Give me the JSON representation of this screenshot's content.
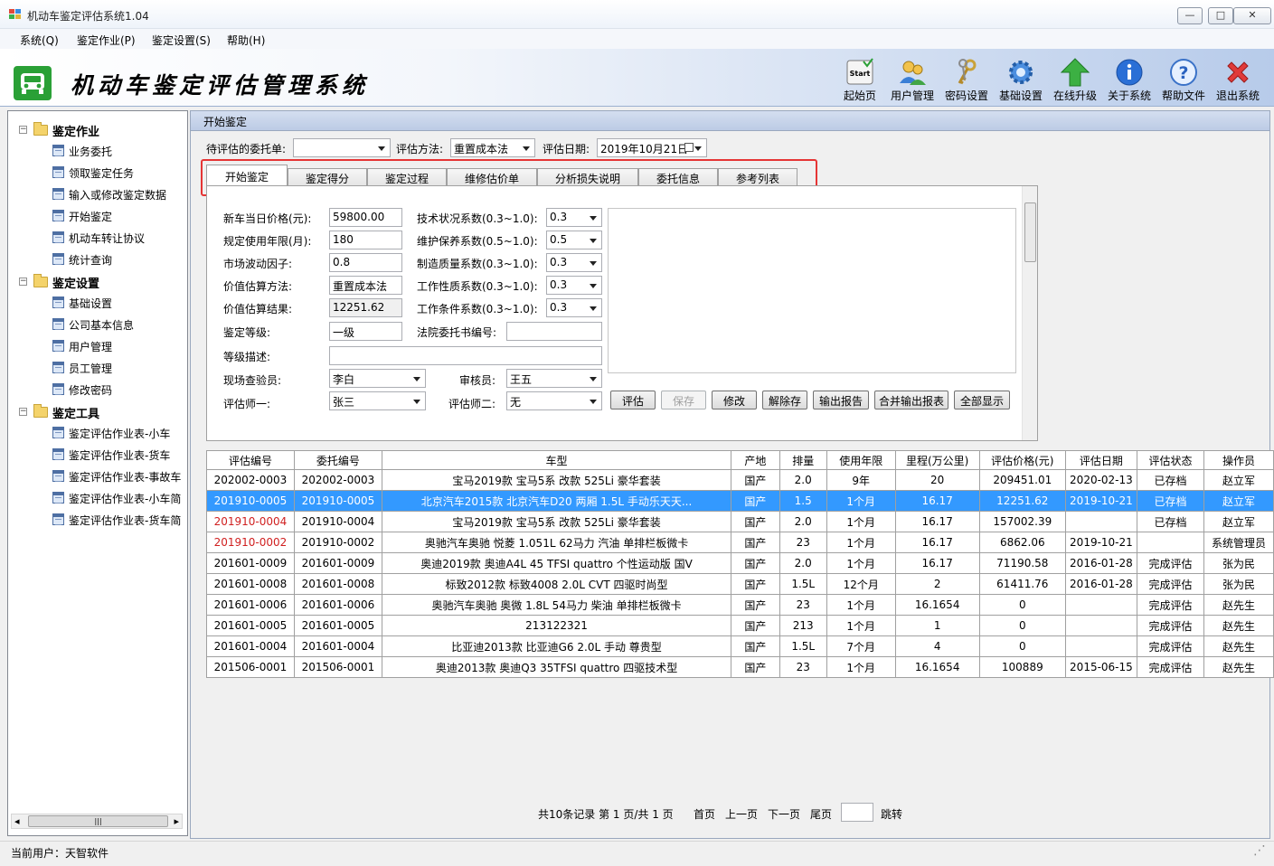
{
  "window": {
    "title": "机动车鉴定评估系统1.04",
    "min": "—",
    "max": "□",
    "close": "✕"
  },
  "menu": [
    "系统(Q)",
    "鉴定作业(P)",
    "鉴定设置(S)",
    "帮助(H)"
  ],
  "banner": {
    "title": "机动车鉴定评估管理系统"
  },
  "toolbar": [
    {
      "label": "起始页",
      "icon": "start-icon"
    },
    {
      "label": "用户管理",
      "icon": "users-icon"
    },
    {
      "label": "密码设置",
      "icon": "keys-icon"
    },
    {
      "label": "基础设置",
      "icon": "gear-icon"
    },
    {
      "label": "在线升级",
      "icon": "up-arrow-icon"
    },
    {
      "label": "关于系统",
      "icon": "info-icon"
    },
    {
      "label": "帮助文件",
      "icon": "help-icon"
    },
    {
      "label": "退出系统",
      "icon": "exit-icon"
    }
  ],
  "tree": {
    "groups": [
      {
        "label": "鉴定作业",
        "expander": "−",
        "items": [
          "业务委托",
          "领取鉴定任务",
          "输入或修改鉴定数据",
          "开始鉴定",
          "机动车转让协议",
          "统计查询"
        ]
      },
      {
        "label": "鉴定设置",
        "expander": "−",
        "items": [
          "基础设置",
          "公司基本信息",
          "用户管理",
          "员工管理",
          "修改密码"
        ]
      },
      {
        "label": "鉴定工具",
        "expander": "−",
        "items": [
          "鉴定评估作业表-小车",
          "鉴定评估作业表-货车",
          "鉴定评估作业表-事故车",
          "鉴定评估作业表-小车简",
          "鉴定评估作业表-货车简"
        ]
      }
    ],
    "scroll_thumb": "|||",
    "scroll_left": "◂",
    "scroll_right": "▸"
  },
  "panel": {
    "title": "开始鉴定"
  },
  "filter": {
    "entrust_label": "待评估的委托单:",
    "entrust_value": "",
    "method_label": "评估方法:",
    "method_value": "重置成本法",
    "date_label": "评估日期:",
    "date_value": "2019年10月21日"
  },
  "tabs": [
    "开始鉴定",
    "鉴定得分",
    "鉴定过程",
    "维修估价单",
    "分析损失说明",
    "委托信息",
    "参考列表"
  ],
  "form": {
    "new_price_label": "新车当日价格(元):",
    "new_price": "59800.00",
    "life_label": "规定使用年限(月):",
    "life": "180",
    "market_label": "市场波动因子:",
    "market": "0.8",
    "calc_method_label": "价值估算方法:",
    "calc_method": "重置成本法",
    "calc_result_label": "价值估算结果:",
    "calc_result": "12251.62",
    "grade_label": "鉴定等级:",
    "grade": "一级",
    "grade_desc_label": "等级描述:",
    "grade_desc": "",
    "inspector_label": "现场查验员:",
    "inspector": "李白",
    "assessor1_label": "评估师一:",
    "assessor1": "张三",
    "tech_label": "技术状况系数(0.3~1.0):",
    "tech": "0.3",
    "maint_label": "维护保养系数(0.5~1.0):",
    "maint": "0.5",
    "quality_label": "制造质量系数(0.3~1.0):",
    "quality": "0.3",
    "work_nature_label": "工作性质系数(0.3~1.0):",
    "work_nature": "0.3",
    "work_cond_label": "工作条件系数(0.3~1.0):",
    "work_cond": "0.3",
    "court_label": "法院委托书编号:",
    "court": "",
    "reviewer_label": "审核员:",
    "reviewer": "王五",
    "assessor2_label": "评估师二:",
    "assessor2": "无"
  },
  "actions": [
    "评估",
    "保存",
    "修改",
    "解除存",
    "输出报告",
    "合并输出报表",
    "全部显示"
  ],
  "grid": {
    "columns": [
      "评估编号",
      "委托编号",
      "车型",
      "产地",
      "排量",
      "使用年限",
      "里程(万公里)",
      "评估价格(元)",
      "评估日期",
      "评估状态",
      "操作员"
    ],
    "rows": [
      [
        "202002-0003",
        "202002-0003",
        "宝马2019款 宝马5系 改款 525Li 豪华套装",
        "国产",
        "2.0",
        "9年",
        "20",
        "209451.01",
        "2020-02-13",
        "已存档",
        "赵立军"
      ],
      [
        "201910-0005",
        "201910-0005",
        "北京汽车2015款 北京汽车D20 两厢 1.5L 手动乐天天...",
        "国产",
        "1.5",
        "1个月",
        "16.17",
        "12251.62",
        "2019-10-21",
        "已存档",
        "赵立军"
      ],
      [
        "201910-0004",
        "201910-0004",
        "宝马2019款 宝马5系 改款 525Li 豪华套装",
        "国产",
        "2.0",
        "1个月",
        "16.17",
        "157002.39",
        "",
        "已存档",
        "赵立军"
      ],
      [
        "201910-0002",
        "201910-0002",
        "奥驰汽车奥驰 悦菱 1.051L 62马力 汽油 单排栏板微卡",
        "国产",
        "23",
        "1个月",
        "16.17",
        "6862.06",
        "2019-10-21",
        "",
        "系统管理员"
      ],
      [
        "201601-0009",
        "201601-0009",
        "奥迪2019款 奥迪A4L 45 TFSI quattro 个性运动版 国V",
        "国产",
        "2.0",
        "1个月",
        "16.17",
        "71190.58",
        "2016-01-28",
        "完成评估",
        "张为民"
      ],
      [
        "201601-0008",
        "201601-0008",
        "标致2012款 标致4008 2.0L CVT 四驱时尚型",
        "国产",
        "1.5L",
        "12个月",
        "2",
        "61411.76",
        "2016-01-28",
        "完成评估",
        "张为民"
      ],
      [
        "201601-0006",
        "201601-0006",
        "奥驰汽车奥驰 奥微 1.8L 54马力 柴油 单排栏板微卡",
        "国产",
        "23",
        "1个月",
        "16.1654",
        "0",
        "",
        "完成评估",
        "赵先生"
      ],
      [
        "201601-0005",
        "201601-0005",
        "213122321",
        "国产",
        "213",
        "1个月",
        "1",
        "0",
        "",
        "完成评估",
        "赵先生"
      ],
      [
        "201601-0004",
        "201601-0004",
        "比亚迪2013款 比亚迪G6 2.0L 手动 尊贵型",
        "国产",
        "1.5L",
        "7个月",
        "4",
        "0",
        "",
        "完成评估",
        "赵先生"
      ],
      [
        "201506-0001",
        "201506-0001",
        "奥迪2013款 奥迪Q3 35TFSI quattro 四驱技术型",
        "国产",
        "23",
        "1个月",
        "16.1654",
        "100889",
        "2015-06-15",
        "完成评估",
        "赵先生"
      ]
    ],
    "selected_row": 1,
    "red_rows": [
      2,
      3
    ]
  },
  "pager": {
    "summary": "共10条记录 第 1 页/共 1 页",
    "first": "首页",
    "prev": "上一页",
    "next": "下一页",
    "last": "尾页",
    "goto": "跳转",
    "page_input": ""
  },
  "status": {
    "current_user": "当前用户：天智软件",
    "grip": "⋰"
  }
}
